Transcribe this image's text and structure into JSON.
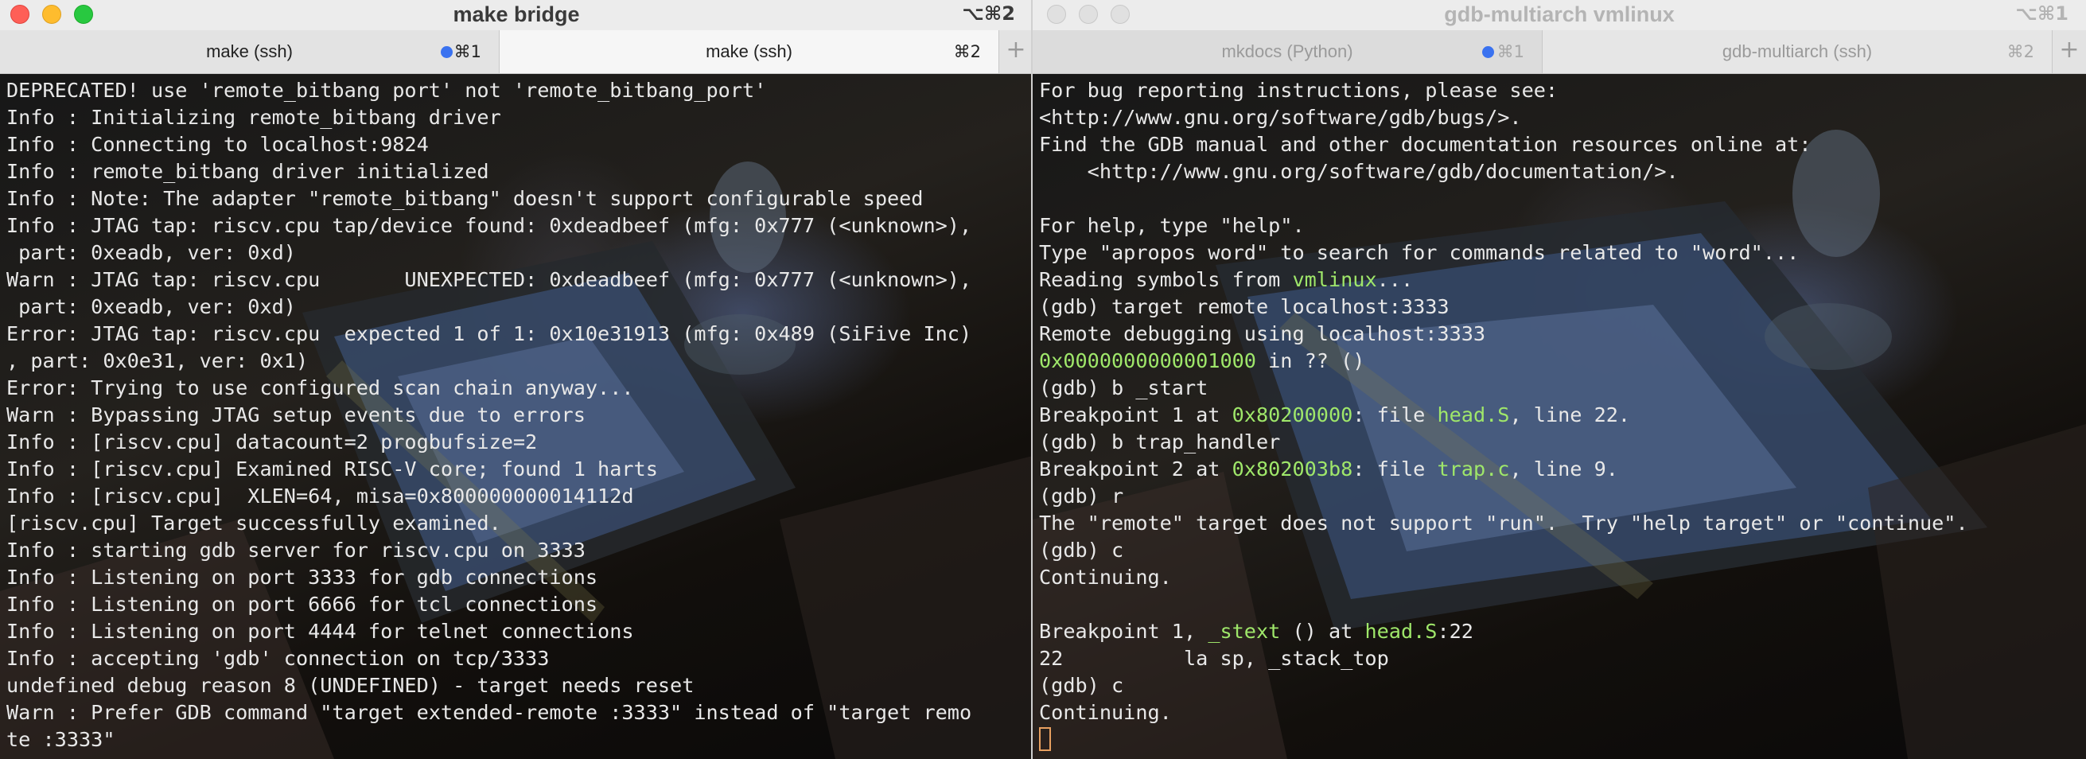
{
  "left": {
    "title": "make bridge",
    "shortcut": "⌥⌘2",
    "tabs": [
      {
        "label": "make (ssh)",
        "shortcut": "⌘1"
      },
      {
        "label": "make (ssh)",
        "shortcut": "⌘2"
      }
    ],
    "lines": [
      "DEPRECATED! use 'remote_bitbang port' not 'remote_bitbang_port'",
      "Info : Initializing remote_bitbang driver",
      "Info : Connecting to localhost:9824",
      "Info : remote_bitbang driver initialized",
      "Info : Note: The adapter \"remote_bitbang\" doesn't support configurable speed",
      "Info : JTAG tap: riscv.cpu tap/device found: 0xdeadbeef (mfg: 0x777 (<unknown>),",
      " part: 0xeadb, ver: 0xd)",
      "Warn : JTAG tap: riscv.cpu       UNEXPECTED: 0xdeadbeef (mfg: 0x777 (<unknown>),",
      " part: 0xeadb, ver: 0xd)",
      "Error: JTAG tap: riscv.cpu  expected 1 of 1: 0x10e31913 (mfg: 0x489 (SiFive Inc)",
      ", part: 0x0e31, ver: 0x1)",
      "Error: Trying to use configured scan chain anyway...",
      "Warn : Bypassing JTAG setup events due to errors",
      "Info : [riscv.cpu] datacount=2 progbufsize=2",
      "Info : [riscv.cpu] Examined RISC-V core; found 1 harts",
      "Info : [riscv.cpu]  XLEN=64, misa=0x800000000014112d",
      "[riscv.cpu] Target successfully examined.",
      "Info : starting gdb server for riscv.cpu on 3333",
      "Info : Listening on port 3333 for gdb connections",
      "Info : Listening on port 6666 for tcl connections",
      "Info : Listening on port 4444 for telnet connections",
      "Info : accepting 'gdb' connection on tcp/3333",
      "undefined debug reason 8 (UNDEFINED) - target needs reset",
      "Warn : Prefer GDB command \"target extended-remote :3333\" instead of \"target remo",
      "te :3333\""
    ]
  },
  "right": {
    "title": "gdb-multiarch vmlinux",
    "shortcut": "⌥⌘1",
    "tabs": [
      {
        "label": "mkdocs (Python)",
        "shortcut": "⌘1"
      },
      {
        "label": "gdb-multiarch (ssh)",
        "shortcut": "⌘2"
      }
    ],
    "lines": [
      [
        {
          "t": "For bug reporting instructions, please see:"
        }
      ],
      [
        {
          "t": "<http://www.gnu.org/software/gdb/bugs/>."
        }
      ],
      [
        {
          "t": "Find the GDB manual and other documentation resources online at:"
        }
      ],
      [
        {
          "t": "    <http://www.gnu.org/software/gdb/documentation/>."
        }
      ],
      [
        {
          "t": ""
        }
      ],
      [
        {
          "t": "For help, type \"help\"."
        }
      ],
      [
        {
          "t": "Type \"apropos word\" to search for commands related to \"word\"..."
        }
      ],
      [
        {
          "t": "Reading symbols from "
        },
        {
          "t": "vmlinux",
          "c": "hl"
        },
        {
          "t": "..."
        }
      ],
      [
        {
          "t": "(gdb) target remote localhost:3333"
        }
      ],
      [
        {
          "t": "Remote debugging using localhost:3333"
        }
      ],
      [
        {
          "t": "0x0000000000001000",
          "c": "hl"
        },
        {
          "t": " in ?? ()"
        }
      ],
      [
        {
          "t": "(gdb) b _start"
        }
      ],
      [
        {
          "t": "Breakpoint 1 at "
        },
        {
          "t": "0x80200000",
          "c": "hl"
        },
        {
          "t": ": file "
        },
        {
          "t": "head.S",
          "c": "hl"
        },
        {
          "t": ", line 22."
        }
      ],
      [
        {
          "t": "(gdb) b trap_handler"
        }
      ],
      [
        {
          "t": "Breakpoint 2 at "
        },
        {
          "t": "0x802003b8",
          "c": "hl"
        },
        {
          "t": ": file "
        },
        {
          "t": "trap.c",
          "c": "hl"
        },
        {
          "t": ", line 9."
        }
      ],
      [
        {
          "t": "(gdb) r"
        }
      ],
      [
        {
          "t": "The \"remote\" target does not support \"run\".  Try \"help target\" or \"continue\"."
        }
      ],
      [
        {
          "t": "(gdb) c"
        }
      ],
      [
        {
          "t": "Continuing."
        }
      ],
      [
        {
          "t": ""
        }
      ],
      [
        {
          "t": "Breakpoint 1, "
        },
        {
          "t": "_stext",
          "c": "hl"
        },
        {
          "t": " () at "
        },
        {
          "t": "head.S",
          "c": "hl"
        },
        {
          "t": ":22"
        }
      ],
      [
        {
          "t": "22          la sp, _stack_top"
        }
      ],
      [
        {
          "t": "(gdb) c"
        }
      ],
      [
        {
          "t": "Continuing."
        }
      ]
    ]
  },
  "colors": {
    "highlight": "#9fe76a",
    "text": "#e8e8e8",
    "tab_dot": "#3a72f0",
    "cursor": "#e8a060"
  },
  "icons": {
    "close": "close-icon",
    "minimize": "minimize-icon",
    "zoom": "zoom-icon",
    "new_tab": "plus-icon"
  }
}
